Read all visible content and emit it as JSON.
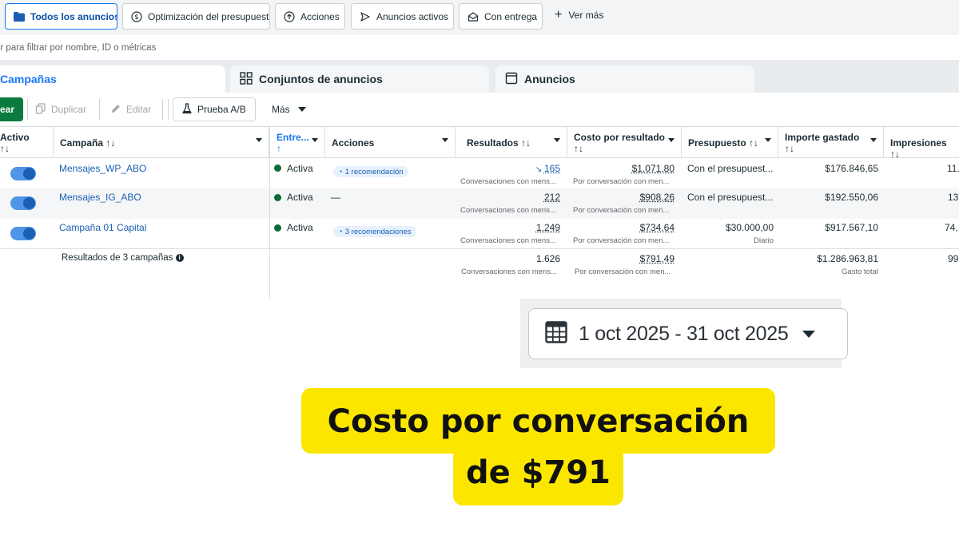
{
  "filters": {
    "chips": [
      {
        "label": "Todos los anuncios",
        "icon": "folder-icon",
        "active": true
      },
      {
        "label": "Optimización del presupuesto",
        "icon": "dollar-circle-icon"
      },
      {
        "label": "Acciones",
        "icon": "arrow-up-circle-icon"
      },
      {
        "label": "Anuncios activos",
        "icon": "play-outline-icon"
      },
      {
        "label": "Con entrega",
        "icon": "envelope-open-icon"
      }
    ],
    "more_label": "Ver más"
  },
  "search": {
    "placeholder": "ar para filtrar por nombre, ID o métricas"
  },
  "tabs": [
    {
      "label": "Campañas",
      "icon": "campaign-icon",
      "selected": true
    },
    {
      "label": "Conjuntos de anuncios",
      "icon": "grid-icon"
    },
    {
      "label": "Anuncios",
      "icon": "ad-window-icon"
    }
  ],
  "toolbar": {
    "create_label": "ear",
    "duplicate_label": "Duplicar",
    "edit_label": "Editar",
    "ab_test_label": "Prueba A/B",
    "more_label": "Más"
  },
  "table": {
    "headers": {
      "active": "Activo",
      "campaign": "Campaña ↑↓",
      "delivery": "Entre...",
      "actions": "Acciones",
      "results": "Resultados ↑↓",
      "cost_per_result": "Costo por resultado",
      "budget": "Presupuesto ↑↓",
      "amount_spent": "Importe gastado",
      "impressions": "Impresiones ↑↓",
      "sort": "↑↓",
      "sort_up": "↑"
    },
    "rows": [
      {
        "name": "Mensajes_WP_ABO",
        "status": "Activa",
        "action": "1 recomendación",
        "results": "165",
        "results_sub": "Conversaciones con mens...",
        "cost": "$1.071,80",
        "cost_sub": "Por conversación con men...",
        "budget": "Con el presupuest...",
        "budget_sub": "",
        "spent": "$176.846,65",
        "impressions": "11."
      },
      {
        "name": "Mensajes_IG_ABO",
        "status": "Activa",
        "action": "—",
        "results": "212",
        "results_sub": "Conversaciones con mens...",
        "cost": "$908,26",
        "cost_sub": "Por conversación con men...",
        "budget": "Con el presupuest...",
        "budget_sub": "",
        "spent": "$192.550,06",
        "impressions": "13"
      },
      {
        "name": "Campaña 01 Capital",
        "status": "Activa",
        "action": "3 recomendaciones",
        "results": "1.249",
        "results_sub": "Conversaciones con mens...",
        "cost": "$734,64",
        "cost_sub": "Por conversación con men...",
        "budget": "$30.000,00",
        "budget_sub": "Diario",
        "spent": "$917.567,10",
        "impressions": "74,"
      }
    ],
    "totals": {
      "label": "Resultados de 3 campañas",
      "results": "1.626",
      "results_sub": "Conversaciones con mens...",
      "cost": "$791,49",
      "cost_sub": "Por conversación con men...",
      "spent": "$1.286.963,81",
      "spent_sub": "Gasto total",
      "impressions": "99"
    }
  },
  "date_range": {
    "label": "1 oct 2025 - 31 oct 2025"
  },
  "caption": {
    "line1": "Costo por conversación",
    "line2": "de $791"
  },
  "colors": {
    "accent": "#1877f2",
    "create_green": "#0b7a3e",
    "caption_yellow": "#fbe600"
  }
}
